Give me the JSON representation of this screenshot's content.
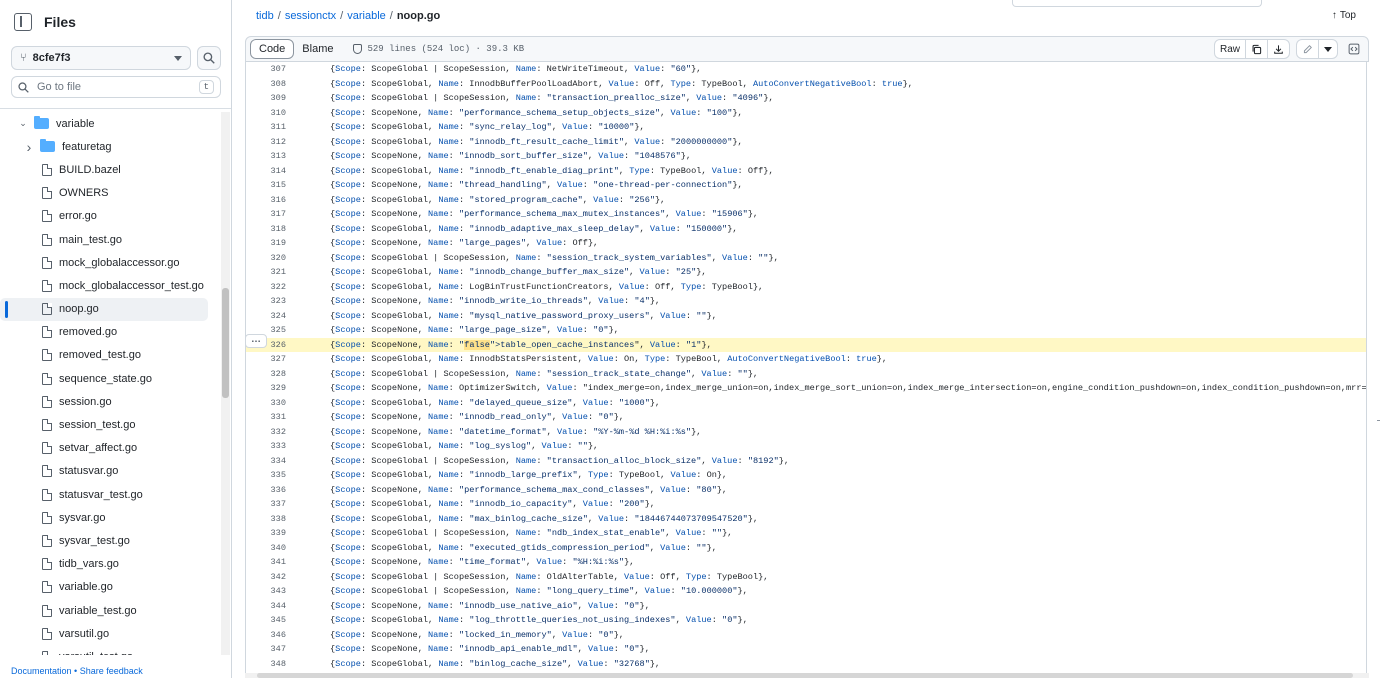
{
  "sidebar": {
    "title": "Files",
    "branch": "8cfe7f3",
    "goto_placeholder": "Go to file",
    "goto_shortcut": "t",
    "footer_docs": "Documentation",
    "footer_sep": " • ",
    "footer_feedback": "Share feedback",
    "tree": [
      {
        "label": "variable",
        "type": "folder",
        "expanded": true,
        "indent": 0
      },
      {
        "label": "featuretag",
        "type": "folder",
        "expanded": false,
        "indent": 1
      },
      {
        "label": "BUILD.bazel",
        "type": "file",
        "indent": 1
      },
      {
        "label": "OWNERS",
        "type": "file",
        "indent": 1
      },
      {
        "label": "error.go",
        "type": "file",
        "indent": 1
      },
      {
        "label": "main_test.go",
        "type": "file",
        "indent": 1
      },
      {
        "label": "mock_globalaccessor.go",
        "type": "file",
        "indent": 1
      },
      {
        "label": "mock_globalaccessor_test.go",
        "type": "file",
        "indent": 1
      },
      {
        "label": "noop.go",
        "type": "file",
        "indent": 1,
        "selected": true
      },
      {
        "label": "removed.go",
        "type": "file",
        "indent": 1
      },
      {
        "label": "removed_test.go",
        "type": "file",
        "indent": 1
      },
      {
        "label": "sequence_state.go",
        "type": "file",
        "indent": 1
      },
      {
        "label": "session.go",
        "type": "file",
        "indent": 1
      },
      {
        "label": "session_test.go",
        "type": "file",
        "indent": 1
      },
      {
        "label": "setvar_affect.go",
        "type": "file",
        "indent": 1
      },
      {
        "label": "statusvar.go",
        "type": "file",
        "indent": 1
      },
      {
        "label": "statusvar_test.go",
        "type": "file",
        "indent": 1
      },
      {
        "label": "sysvar.go",
        "type": "file",
        "indent": 1
      },
      {
        "label": "sysvar_test.go",
        "type": "file",
        "indent": 1
      },
      {
        "label": "tidb_vars.go",
        "type": "file",
        "indent": 1
      },
      {
        "label": "variable.go",
        "type": "file",
        "indent": 1
      },
      {
        "label": "variable_test.go",
        "type": "file",
        "indent": 1
      },
      {
        "label": "varsutil.go",
        "type": "file",
        "indent": 1
      },
      {
        "label": "varsutil_test.go",
        "type": "file",
        "indent": 1
      }
    ]
  },
  "breadcrumb": [
    "tidb",
    "sessionctx",
    "variable",
    "noop.go"
  ],
  "top_label": "Top",
  "file_header": {
    "tab_code": "Code",
    "tab_blame": "Blame",
    "meta": "529 lines (524 loc) · 39.3 KB",
    "raw_label": "Raw"
  },
  "code": {
    "highlight_line": 326,
    "selected_text": "table_open_cache_instances",
    "lines": [
      {
        "n": "307",
        "t": "{Scope: ScopeGlobal | ScopeSession, Name: NetWriteTimeout, Value: \"60\"},"
      },
      {
        "n": "308",
        "t": "{Scope: ScopeGlobal, Name: InnodbBufferPoolLoadAbort, Value: Off, Type: TypeBool, AutoConvertNegativeBool: true},"
      },
      {
        "n": "309",
        "t": "{Scope: ScopeGlobal | ScopeSession, Name: \"transaction_prealloc_size\", Value: \"4096\"},"
      },
      {
        "n": "310",
        "t": "{Scope: ScopeNone, Name: \"performance_schema_setup_objects_size\", Value: \"100\"},"
      },
      {
        "n": "311",
        "t": "{Scope: ScopeGlobal, Name: \"sync_relay_log\", Value: \"10000\"},"
      },
      {
        "n": "312",
        "t": "{Scope: ScopeGlobal, Name: \"innodb_ft_result_cache_limit\", Value: \"2000000000\"},"
      },
      {
        "n": "313",
        "t": "{Scope: ScopeNone, Name: \"innodb_sort_buffer_size\", Value: \"1048576\"},"
      },
      {
        "n": "314",
        "t": "{Scope: ScopeGlobal, Name: \"innodb_ft_enable_diag_print\", Type: TypeBool, Value: Off},"
      },
      {
        "n": "315",
        "t": "{Scope: ScopeNone, Name: \"thread_handling\", Value: \"one-thread-per-connection\"},"
      },
      {
        "n": "316",
        "t": "{Scope: ScopeGlobal, Name: \"stored_program_cache\", Value: \"256\"},"
      },
      {
        "n": "317",
        "t": "{Scope: ScopeNone, Name: \"performance_schema_max_mutex_instances\", Value: \"15906\"},"
      },
      {
        "n": "318",
        "t": "{Scope: ScopeGlobal, Name: \"innodb_adaptive_max_sleep_delay\", Value: \"150000\"},"
      },
      {
        "n": "319",
        "t": "{Scope: ScopeNone, Name: \"large_pages\", Value: Off},"
      },
      {
        "n": "320",
        "t": "{Scope: ScopeGlobal | ScopeSession, Name: \"session_track_system_variables\", Value: \"\"},"
      },
      {
        "n": "321",
        "t": "{Scope: ScopeGlobal, Name: \"innodb_change_buffer_max_size\", Value: \"25\"},"
      },
      {
        "n": "322",
        "t": "{Scope: ScopeGlobal, Name: LogBinTrustFunctionCreators, Value: Off, Type: TypeBool},"
      },
      {
        "n": "323",
        "t": "{Scope: ScopeNone, Name: \"innodb_write_io_threads\", Value: \"4\"},"
      },
      {
        "n": "324",
        "t": "{Scope: ScopeGlobal, Name: \"mysql_native_password_proxy_users\", Value: \"\"},"
      },
      {
        "n": "325",
        "t": "{Scope: ScopeNone, Name: \"large_page_size\", Value: \"0\"},"
      },
      {
        "n": "326",
        "t": "{Scope: ScopeNone, Name: \"table_open_cache_instances\", Value: \"1\"},"
      },
      {
        "n": "327",
        "t": "{Scope: ScopeGlobal, Name: InnodbStatsPersistent, Value: On, Type: TypeBool, AutoConvertNegativeBool: true},"
      },
      {
        "n": "328",
        "t": "{Scope: ScopeGlobal | ScopeSession, Name: \"session_track_state_change\", Value: \"\"},"
      },
      {
        "n": "329",
        "t": "{Scope: ScopeNone, Name: OptimizerSwitch, Value: \"index_merge=on,index_merge_union=on,index_merge_sort_union=on,index_merge_intersection=on,engine_condition_pushdown=on,index_condition_pushdown=on,mrr=on,mrr_cost_base"
      },
      {
        "n": "330",
        "t": "{Scope: ScopeGlobal, Name: \"delayed_queue_size\", Value: \"1000\"},"
      },
      {
        "n": "331",
        "t": "{Scope: ScopeNone, Name: \"innodb_read_only\", Value: \"0\"},"
      },
      {
        "n": "332",
        "t": "{Scope: ScopeNone, Name: \"datetime_format\", Value: \"%Y-%m-%d %H:%i:%s\"},"
      },
      {
        "n": "333",
        "t": "{Scope: ScopeGlobal, Name: \"log_syslog\", Value: \"\"},"
      },
      {
        "n": "334",
        "t": "{Scope: ScopeGlobal | ScopeSession, Name: \"transaction_alloc_block_size\", Value: \"8192\"},"
      },
      {
        "n": "335",
        "t": "{Scope: ScopeGlobal, Name: \"innodb_large_prefix\", Type: TypeBool, Value: On},"
      },
      {
        "n": "336",
        "t": "{Scope: ScopeNone, Name: \"performance_schema_max_cond_classes\", Value: \"80\"},"
      },
      {
        "n": "337",
        "t": "{Scope: ScopeGlobal, Name: \"innodb_io_capacity\", Value: \"200\"},"
      },
      {
        "n": "338",
        "t": "{Scope: ScopeGlobal, Name: \"max_binlog_cache_size\", Value: \"18446744073709547520\"},"
      },
      {
        "n": "339",
        "t": "{Scope: ScopeGlobal | ScopeSession, Name: \"ndb_index_stat_enable\", Value: \"\"},"
      },
      {
        "n": "340",
        "t": "{Scope: ScopeGlobal, Name: \"executed_gtids_compression_period\", Value: \"\"},"
      },
      {
        "n": "341",
        "t": "{Scope: ScopeNone, Name: \"time_format\", Value: \"%H:%i:%s\"},"
      },
      {
        "n": "342",
        "t": "{Scope: ScopeGlobal | ScopeSession, Name: OldAlterTable, Value: Off, Type: TypeBool},"
      },
      {
        "n": "343",
        "t": "{Scope: ScopeGlobal | ScopeSession, Name: \"long_query_time\", Value: \"10.000000\"},"
      },
      {
        "n": "344",
        "t": "{Scope: ScopeNone, Name: \"innodb_use_native_aio\", Value: \"0\"},"
      },
      {
        "n": "345",
        "t": "{Scope: ScopeGlobal, Name: \"log_throttle_queries_not_using_indexes\", Value: \"0\"},"
      },
      {
        "n": "346",
        "t": "{Scope: ScopeNone, Name: \"locked_in_memory\", Value: \"0\"},"
      },
      {
        "n": "347",
        "t": "{Scope: ScopeNone, Name: \"innodb_api_enable_mdl\", Value: \"0\"},"
      },
      {
        "n": "348",
        "t": "{Scope: ScopeGlobal, Name: \"binlog_cache_size\", Value: \"32768\"},"
      }
    ]
  }
}
